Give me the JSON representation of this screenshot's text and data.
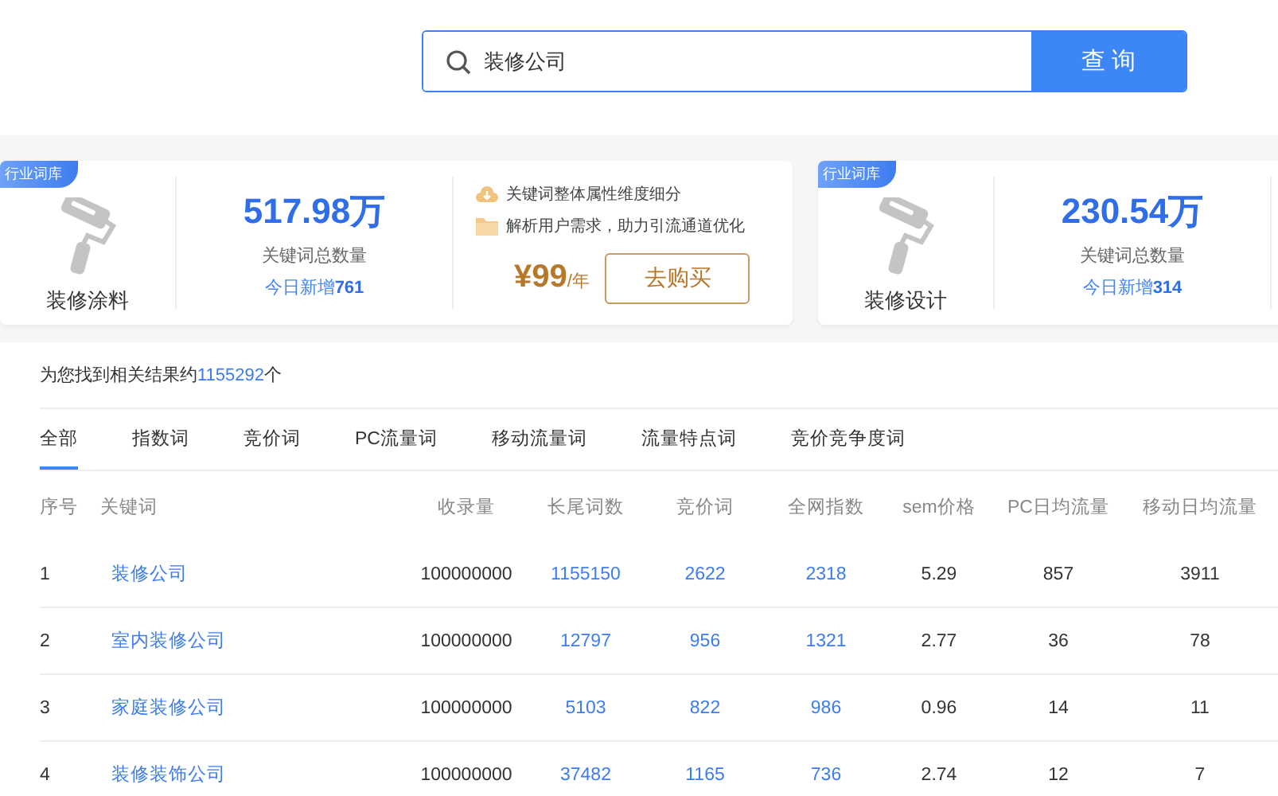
{
  "search": {
    "value": "装修公司",
    "button": "查 询"
  },
  "cards": [
    {
      "badge": "行业词库",
      "name": "装修涂料",
      "total": "517.98",
      "unit": "万",
      "total_label": "关键词总数量",
      "today_label": "今日新增",
      "today_count": "761",
      "features": [
        {
          "kind": "cloud",
          "text": "关键词整体属性维度细分"
        },
        {
          "kind": "folder",
          "text": "解析用户需求，助力引流通道优化"
        }
      ],
      "price": "¥99",
      "price_unit": "/年",
      "buy": "去购买"
    },
    {
      "badge": "行业词库",
      "name": "装修设计",
      "total": "230.54",
      "unit": "万",
      "total_label": "关键词总数量",
      "today_label": "今日新增",
      "today_count": "314"
    }
  ],
  "results": {
    "prefix": "为您找到相关结果约",
    "count": "1155292",
    "suffix": "个"
  },
  "tabs": [
    {
      "label": "全部",
      "selected": true
    },
    {
      "label": "指数词",
      "selected": false
    },
    {
      "label": "竞价词",
      "selected": false
    },
    {
      "label": "PC流量词",
      "selected": false
    },
    {
      "label": "移动流量词",
      "selected": false
    },
    {
      "label": "流量特点词",
      "selected": false
    },
    {
      "label": "竞价竞争度词",
      "selected": false
    }
  ],
  "table": {
    "columns": [
      {
        "label": "序号",
        "link": false
      },
      {
        "label": "关键词",
        "link": true
      },
      {
        "label": "收录量",
        "link": false
      },
      {
        "label": "长尾词数",
        "link": true
      },
      {
        "label": "竞价词",
        "link": true
      },
      {
        "label": "全网指数",
        "link": true
      },
      {
        "label": "sem价格",
        "link": false
      },
      {
        "label": "PC日均流量",
        "link": false
      },
      {
        "label": "移动日均流量",
        "link": false
      }
    ],
    "rows": [
      {
        "cells": [
          "1",
          "装修公司",
          "100000000",
          "1155150",
          "2622",
          "2318",
          "5.29",
          "857",
          "3911"
        ]
      },
      {
        "cells": [
          "2",
          "室内装修公司",
          "100000000",
          "12797",
          "956",
          "1321",
          "2.77",
          "36",
          "78"
        ]
      },
      {
        "cells": [
          "3",
          "家庭装修公司",
          "100000000",
          "5103",
          "822",
          "986",
          "0.96",
          "14",
          "11"
        ]
      },
      {
        "cells": [
          "4",
          "装修装饰公司",
          "100000000",
          "37482",
          "1165",
          "736",
          "2.74",
          "12",
          "7"
        ]
      }
    ]
  }
}
